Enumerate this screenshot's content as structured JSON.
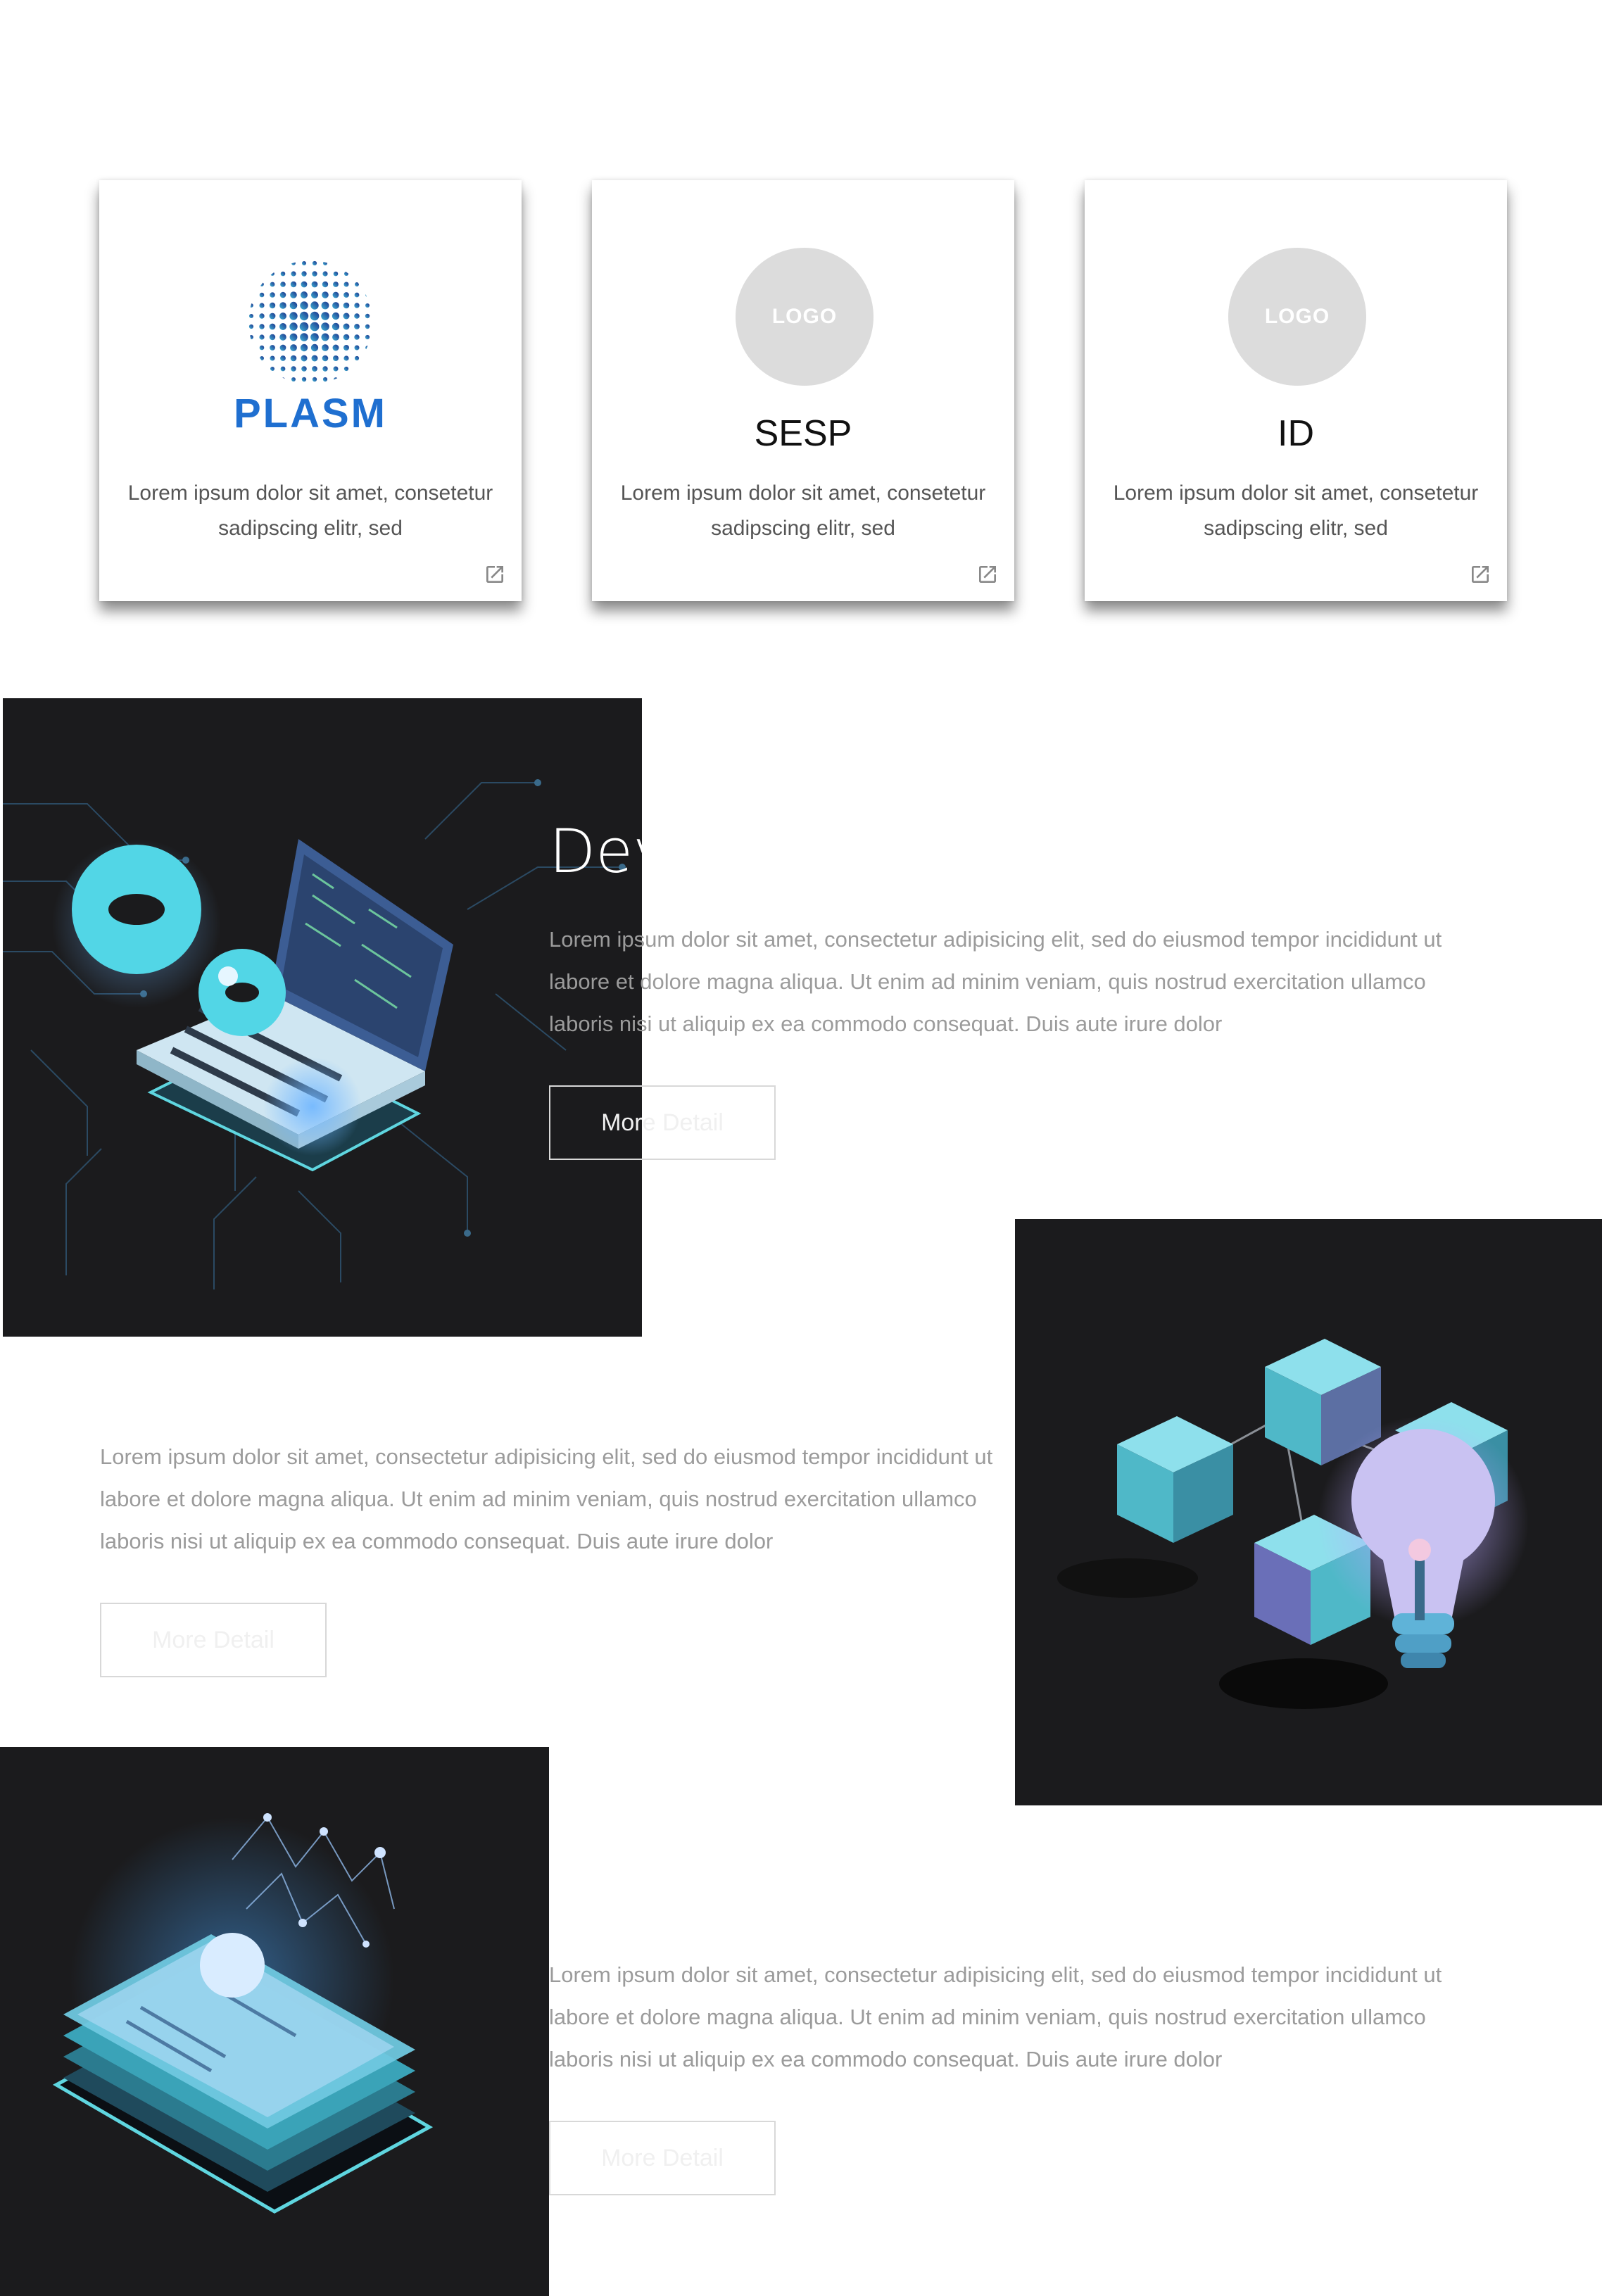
{
  "cards": [
    {
      "logo_word": "PLASM",
      "title": "",
      "description": "Lorem ipsum dolor sit amet, consetetur sadipscing elitr, sed"
    },
    {
      "logo_text": "LOGO",
      "title": "SESP",
      "description": "Lorem ipsum dolor sit amet, consetetur sadipscing elitr, sed"
    },
    {
      "logo_text": "LOGO",
      "title": "ID",
      "description": "Lorem ipsum dolor sit amet, consetetur sadipscing elitr, sed"
    }
  ],
  "features": [
    {
      "heading": "Dev",
      "text": "Lorem ipsum dolor sit amet, consectetur adipisicing elit, sed do eiusmod tempor incididunt ut labore et dolore magna aliqua. Ut enim ad minim veniam, quis nostrud exercitation ullamco laboris nisi ut aliquip ex ea commodo consequat. Duis aute irure dolor",
      "button": "More Detail"
    },
    {
      "text": "Lorem ipsum dolor sit amet, consectetur adipisicing elit, sed do eiusmod tempor incididunt ut labore et dolore magna aliqua. Ut enim ad minim veniam, quis nostrud exercitation ullamco laboris nisi ut aliquip ex ea commodo consequat. Duis aute irure dolor",
      "button": "More Detail"
    },
    {
      "text": "Lorem ipsum dolor sit amet, consectetur adipisicing elit, sed do eiusmod tempor incididunt ut labore et dolore magna aliqua. Ut enim ad minim veniam, quis nostrud exercitation ullamco laboris nisi ut aliquip ex ea commodo consequat. Duis aute irure dolor",
      "button": "More Detail"
    }
  ],
  "icons": {
    "card_link": "external-link-icon"
  },
  "colors": {
    "dark_panel": "#1b1b1d",
    "brand_blue": "#1f6fd0",
    "accent_cyan": "#5fd6e0",
    "logo_placeholder": "#dcdcdc"
  }
}
